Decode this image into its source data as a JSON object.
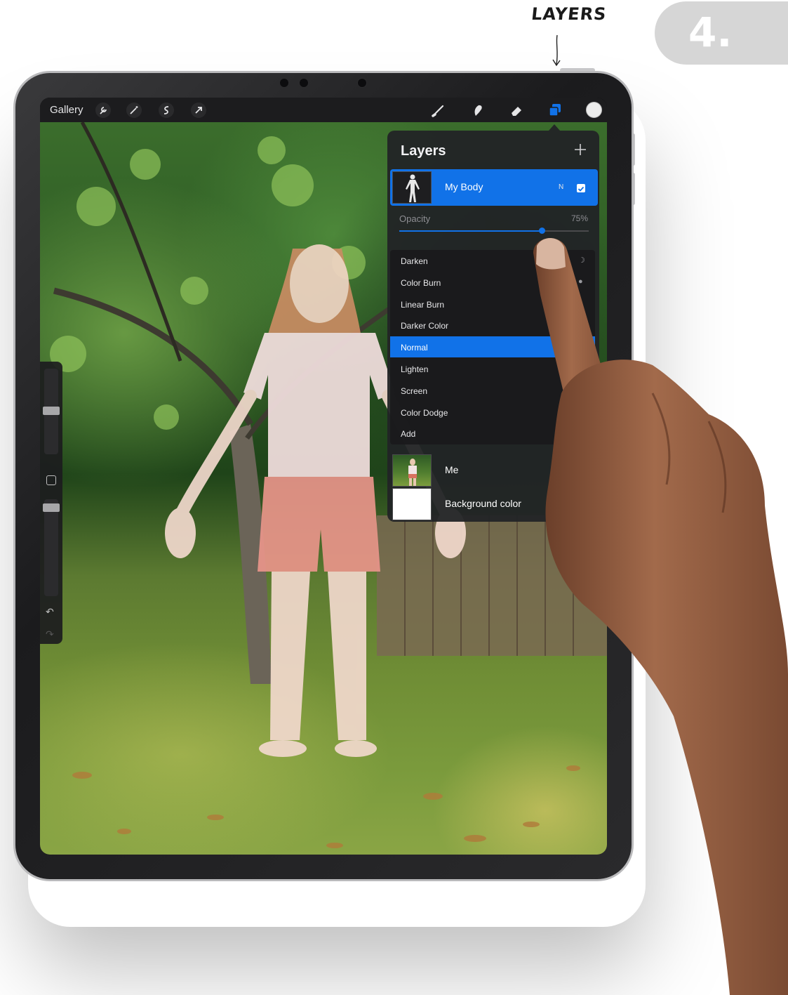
{
  "annotation": {
    "label": "LAYERS",
    "step": "4."
  },
  "toolbar": {
    "gallery_label": "Gallery",
    "left_icons": [
      "wrench-icon",
      "magic-wand-icon",
      "selection-icon",
      "transform-arrow-icon"
    ],
    "right_icons": [
      "brush-icon",
      "smudge-icon",
      "eraser-icon",
      "layers-icon"
    ],
    "accent": "#1172e8"
  },
  "layers_panel": {
    "title": "Layers",
    "active_layer": {
      "name": "My Body",
      "mode": "N",
      "visible": true
    },
    "opacity": {
      "label": "Opacity",
      "value_text": "75%",
      "value": 0.75
    },
    "blend_modes": [
      {
        "label": "Darken",
        "icon": "moon-icon"
      },
      {
        "label": "Color Burn",
        "icon": "burn-icon"
      },
      {
        "label": "Linear Burn",
        "icon": "flame-icon"
      },
      {
        "label": "Darker Color",
        "icon": "circle-icon"
      },
      {
        "label": "Normal",
        "icon": "",
        "selected": true
      },
      {
        "label": "Lighten",
        "icon": ""
      },
      {
        "label": "Screen",
        "icon": ""
      },
      {
        "label": "Color Dodge",
        "icon": ""
      },
      {
        "label": "Add",
        "icon": ""
      }
    ],
    "layers": [
      {
        "name": "Me"
      },
      {
        "name": "Background color"
      }
    ]
  }
}
